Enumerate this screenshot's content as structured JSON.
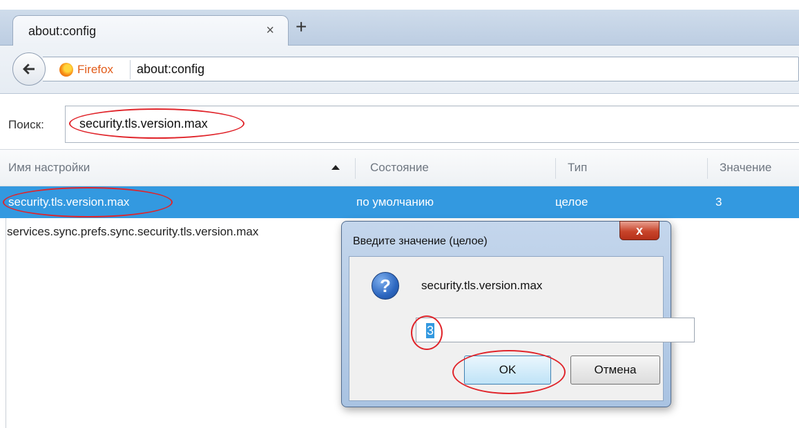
{
  "tab": {
    "title": "about:config",
    "close_glyph": "×",
    "new_tab_glyph": "+"
  },
  "navbar": {
    "identity_label": "Firefox",
    "url": "about:config"
  },
  "search": {
    "label": "Поиск:",
    "value": "security.tls.version.max"
  },
  "columns": [
    "Имя настройки",
    "Состояние",
    "Тип",
    "Значение"
  ],
  "rows": [
    {
      "name": "security.tls.version.max",
      "status": "по умолчанию",
      "type": "целое",
      "value": "3",
      "selected": true
    },
    {
      "name": "services.sync.prefs.sync.security.tls.version.max",
      "status": "",
      "type": "",
      "value": "",
      "selected": false
    }
  ],
  "dialog": {
    "title": "Введите значение (целое)",
    "close_glyph": "x",
    "pref_name": "security.tls.version.max",
    "input_value": "3",
    "ok_label": "OK",
    "cancel_label": "Отмена",
    "icon": "question-icon"
  },
  "colors": {
    "selection": "#3399e0",
    "annotation": "#e0242a"
  }
}
